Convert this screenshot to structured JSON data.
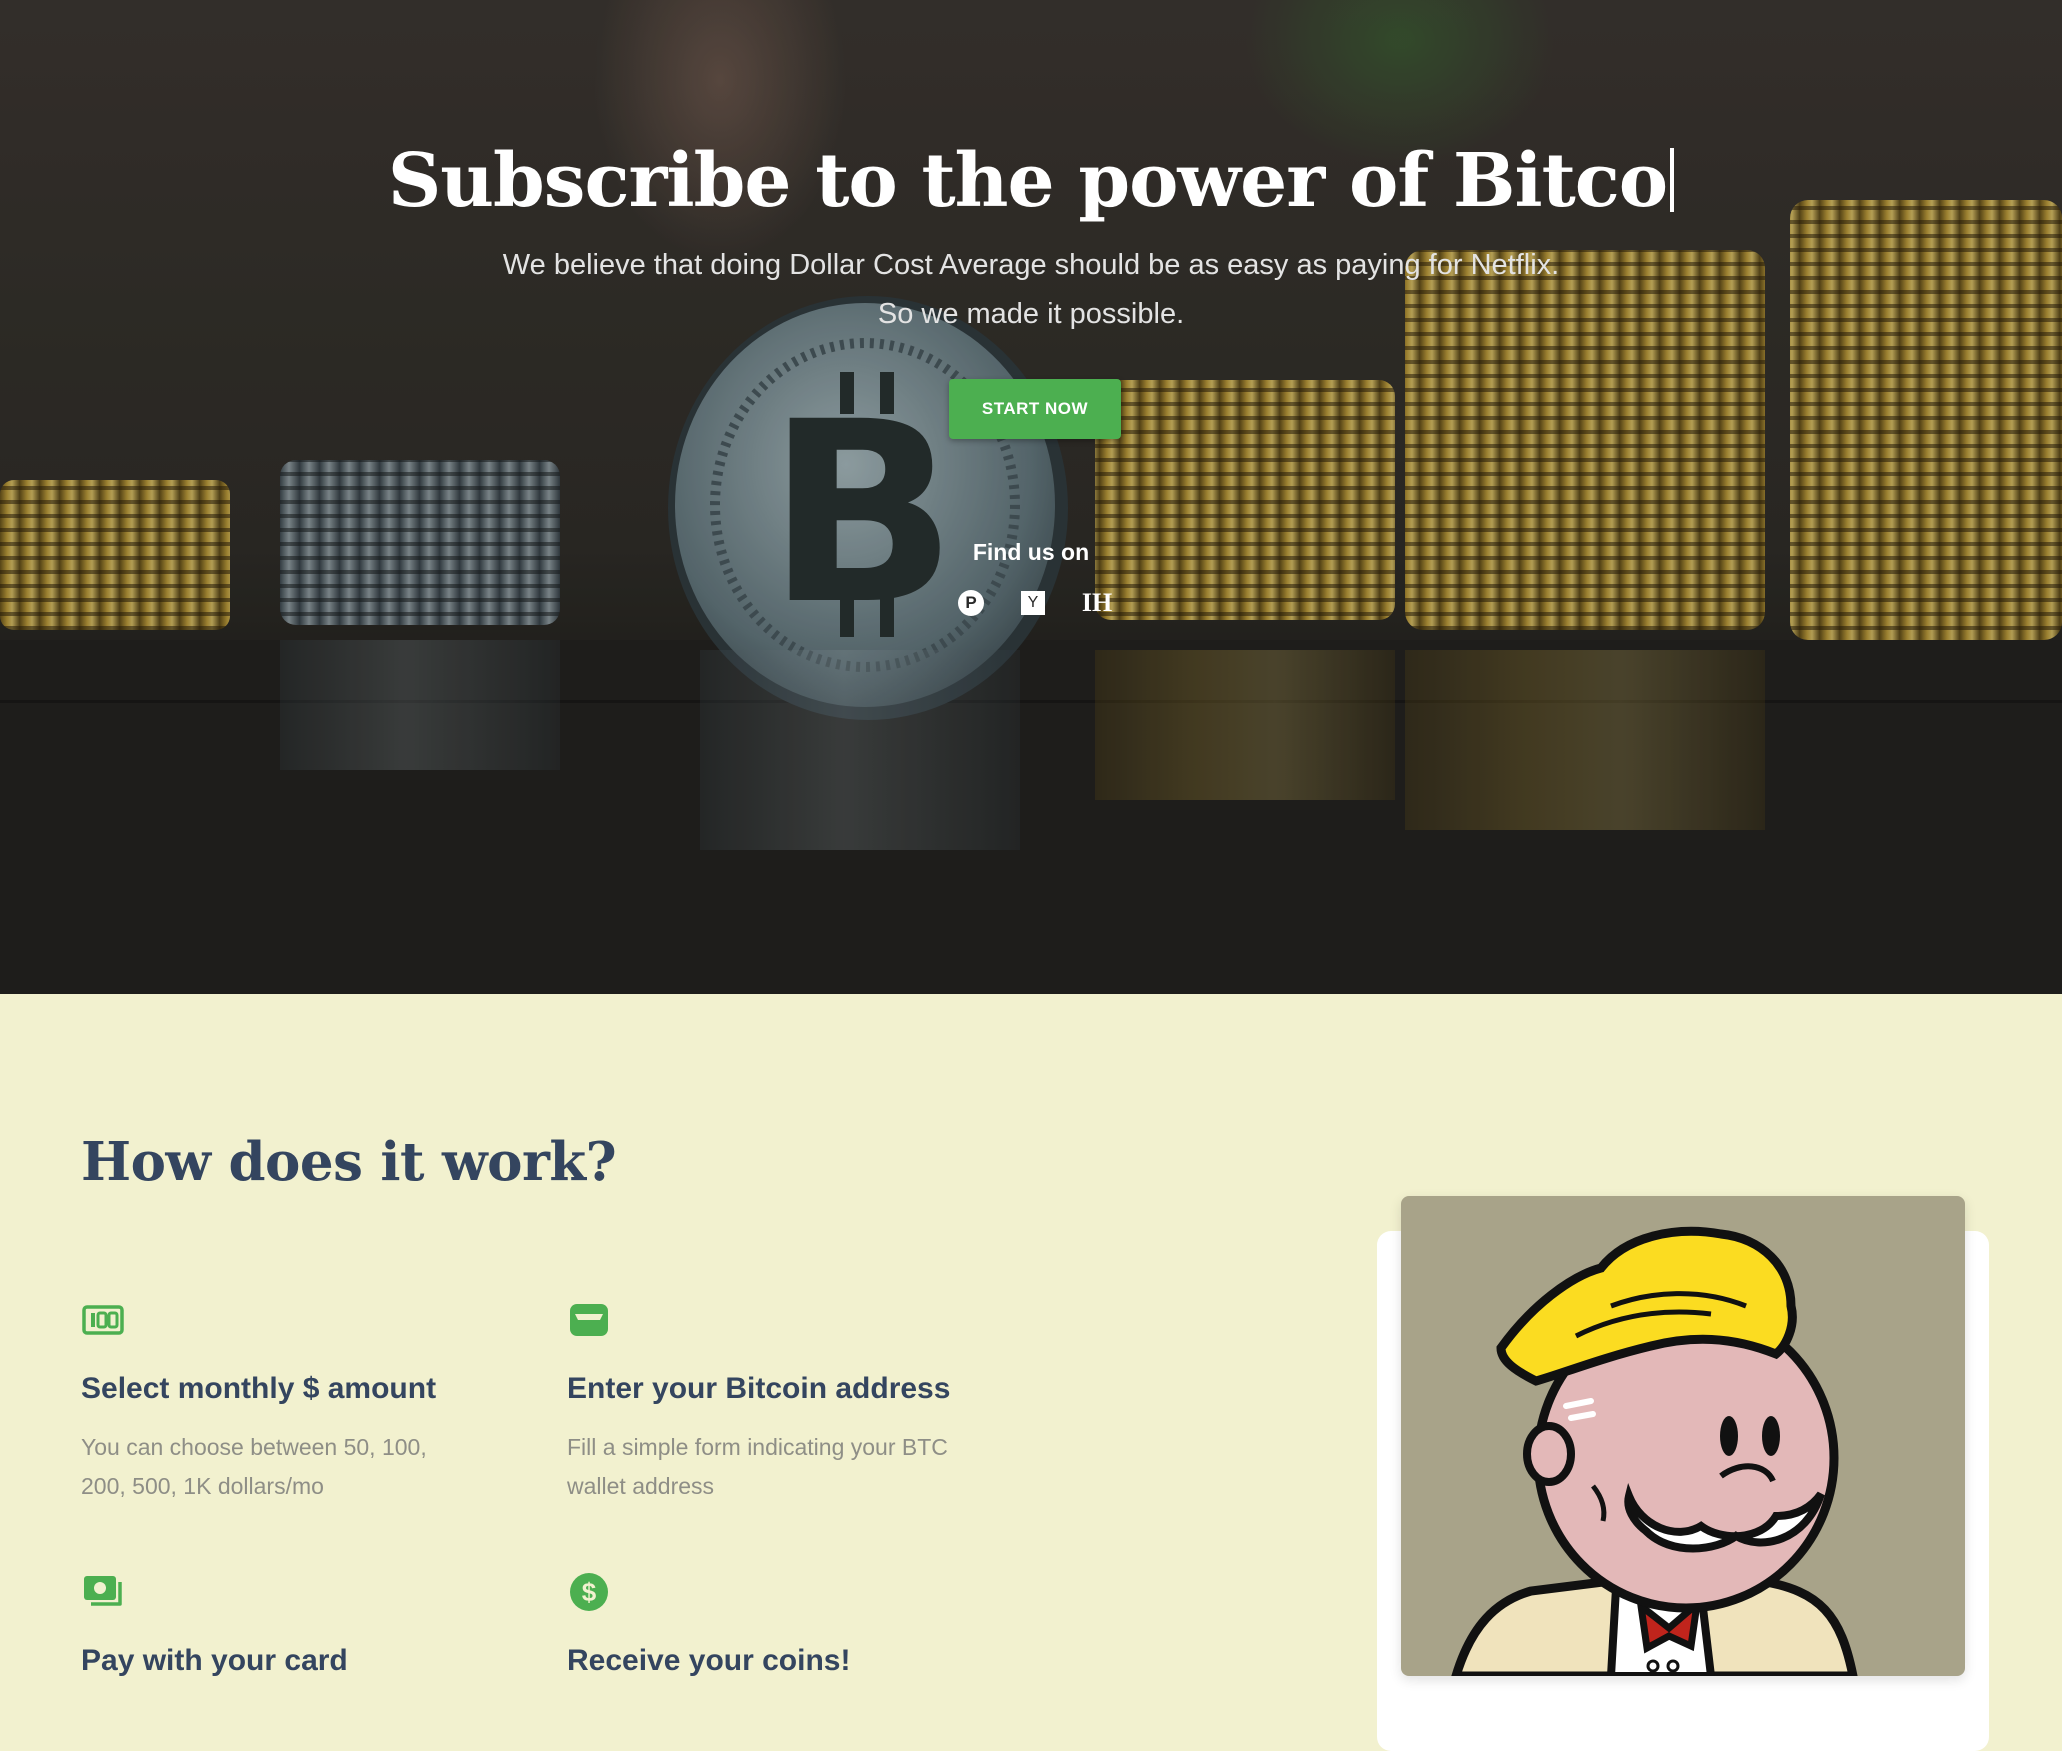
{
  "hero": {
    "title": "Subscribe to the power of Bitco",
    "subtitle_line1": "We believe that doing Dollar Cost Average should be as easy as paying for Netflix.",
    "subtitle_line2": "So we made it possible.",
    "cta_label": "START NOW",
    "find_us_label": "Find us on",
    "social": [
      {
        "icon": "product-hunt-icon",
        "glyph": "P"
      },
      {
        "icon": "y-combinator-icon",
        "glyph": "Y"
      },
      {
        "icon": "indie-hackers-icon",
        "glyph": "IH"
      }
    ]
  },
  "how": {
    "title": "How does it work?",
    "steps": [
      {
        "icon": "cash-icon",
        "title": "Select monthly $ amount",
        "desc": "You can choose between 50, 100, 200, 500, 1K dollars/mo"
      },
      {
        "icon": "wallet-icon",
        "title": "Enter your Bitcoin address",
        "desc": "Fill a simple form indicating your BTC wallet address"
      },
      {
        "icon": "money-bill-icon",
        "title": "Pay with your card",
        "desc": ""
      },
      {
        "icon": "dollar-coin-icon",
        "title": "Receive your coins!",
        "desc": ""
      }
    ]
  },
  "colors": {
    "accent": "#4caf50",
    "heading": "#34455f",
    "muted_text": "#8e8e86",
    "section_bg": "#f2f1cf"
  }
}
